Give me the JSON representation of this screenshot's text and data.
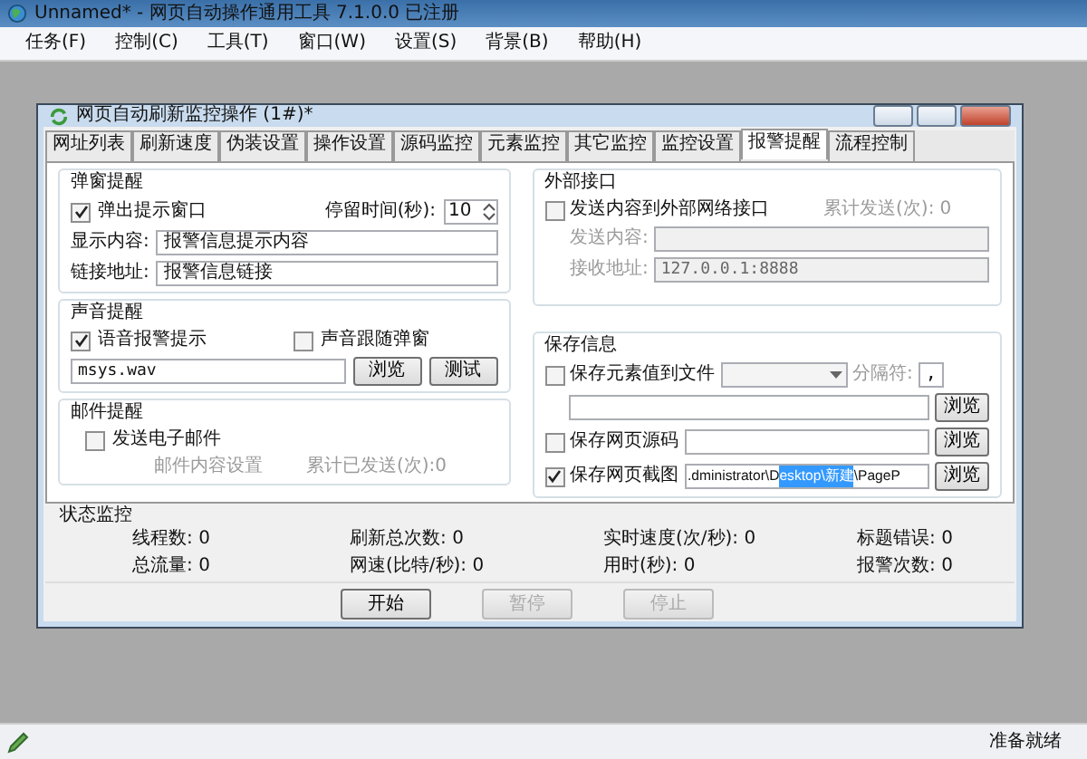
{
  "window": {
    "title": "Unnamed* - 网页自动操作通用工具 7.1.0.0 已注册"
  },
  "menu": [
    "任务(F)",
    "控制(C)",
    "工具(T)",
    "窗口(W)",
    "设置(S)",
    "背景(B)",
    "帮助(H)"
  ],
  "child_window": {
    "title": "网页自动刷新监控操作 (1#)*",
    "tabs": [
      {
        "label": "网址列表",
        "selected": false
      },
      {
        "label": "刷新速度",
        "selected": false
      },
      {
        "label": "伪装设置",
        "selected": false
      },
      {
        "label": "操作设置",
        "selected": false
      },
      {
        "label": "源码监控",
        "selected": false
      },
      {
        "label": "元素监控",
        "selected": false
      },
      {
        "label": "其它监控",
        "selected": false
      },
      {
        "label": "监控设置",
        "selected": false
      },
      {
        "label": "报警提醒",
        "selected": true
      },
      {
        "label": "流程控制",
        "selected": false
      }
    ]
  },
  "popup_alert": {
    "title": "弹窗提醒",
    "checkbox": {
      "label": "弹出提示窗口",
      "checked": true
    },
    "stay_label": "停留时间(秒):",
    "stay_value": "10",
    "fields": [
      {
        "label": "显示内容:",
        "value": "报警信息提示内容"
      },
      {
        "label": "链接地址:",
        "value": "报警信息链接"
      }
    ]
  },
  "sound_alert": {
    "title": "声音提醒",
    "voice_checkbox": {
      "label": "语音报警提示",
      "checked": true
    },
    "follow_checkbox": {
      "label": "声音跟随弹窗",
      "checked": false
    },
    "file": "msys.wav",
    "buttons": [
      "浏览",
      "测试"
    ]
  },
  "mail_alert": {
    "title": "邮件提醒",
    "checkbox": {
      "label": "发送电子邮件",
      "checked": false
    },
    "settings": "邮件内容设置",
    "sent": "累计已发送(次):0"
  },
  "external_interface": {
    "title": "外部接口",
    "checkbox": {
      "label": "发送内容到外部网络接口",
      "checked": false
    },
    "sent_label": "累计发送(次):",
    "sent_value": "0",
    "fields": [
      {
        "label": "发送内容:"
      },
      {
        "label": "接收地址:",
        "value": "127.0.0.1:8888"
      }
    ]
  },
  "save_info": {
    "title": "保存信息",
    "element_row": {
      "label": "保存元素值到文件",
      "checked": false,
      "separator_label": "分隔符:",
      "separator_value": ",",
      "button": "浏览"
    },
    "source_row": {
      "label": "保存网页源码",
      "checked": false,
      "button": "浏览"
    },
    "screenshot_row": {
      "label": "保存网页截图",
      "checked": true,
      "path_before": ".dministrator\\D",
      "path_selected": "esktop\\新建",
      "path_after": "\\PageP",
      "button": "浏览"
    }
  },
  "status_monitor": {
    "title": "状态监控",
    "stats": [
      {
        "label": "线程数:",
        "value": "0"
      },
      {
        "label": "刷新总次数:",
        "value": "0"
      },
      {
        "label": "实时速度(次/秒):",
        "value": "0"
      },
      {
        "label": "标题错误:",
        "value": "0"
      },
      {
        "label": "总流量:",
        "value": "0"
      },
      {
        "label": "网速(比特/秒):",
        "value": "0"
      },
      {
        "label": "用时(秒):",
        "value": "0"
      },
      {
        "label": "报警次数:",
        "value": "0"
      }
    ]
  },
  "buttons": [
    {
      "label": "开始",
      "disabled": false
    },
    {
      "label": "暂停",
      "disabled": true
    },
    {
      "label": "停止",
      "disabled": true
    }
  ],
  "status_bar": {
    "text": "准备就绪"
  }
}
